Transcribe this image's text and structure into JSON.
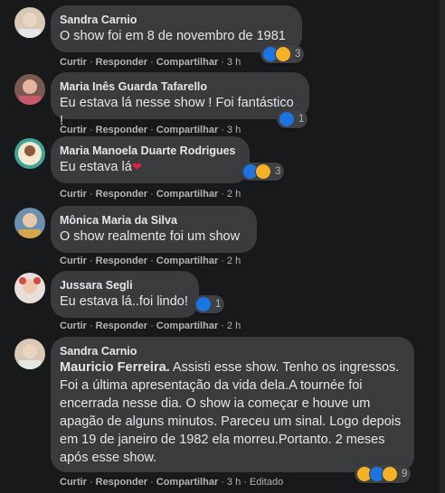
{
  "actions": {
    "like": "Curtir",
    "reply": "Responder",
    "share": "Compartilhar",
    "sep": "·",
    "edited": "Editado"
  },
  "comments": [
    {
      "author": "Sandra Carnio",
      "text": "O show foi em 8 de novembro de 1981",
      "time": "3 h",
      "reactions": [
        "like",
        "wow"
      ],
      "count": "3"
    },
    {
      "author": "Maria Inês Guarda Tafarello",
      "text": "Eu estava lá nesse show ! Foi fantástico !",
      "time": "3 h",
      "reactions": [
        "like"
      ],
      "count": "1"
    },
    {
      "author": "Maria Manoela Duarte Rodrigues",
      "text": "Eu estava lá",
      "emoji": "❤",
      "time": "2 h",
      "reactions": [
        "like",
        "wow"
      ],
      "count": "3"
    },
    {
      "author": "Mônica Maria da Silva",
      "text": "O show realmente foi um show",
      "time": "2 h"
    },
    {
      "author": "Jussara Segli",
      "text": "Eu estava lá..foi lindo!",
      "time": "2 h",
      "reactions": [
        "like"
      ],
      "count": "1"
    },
    {
      "author": "Sandra Carnio",
      "mention": "Mauricio Ferreira.",
      "text": " Assisti esse show. Tenho os ingressos. Foi a última apresentação da vida dela.A tournée foi encerrada nesse dia. O show ia começar e houve um apagão de alguns minutos. Pareceu um sinal. Logo depois em 19 de janeiro de 1982 ela morreu.Portanto. 2 meses após esse show.",
      "time": "3 h",
      "reactions": [
        "wow",
        "like",
        "sad"
      ],
      "count": "9"
    }
  ],
  "colors": {
    "background": "#18191a",
    "bubble": "#3a3b3c",
    "like": "#1b74e4",
    "wow": "#f7b125",
    "heart": "#e41e3f"
  }
}
